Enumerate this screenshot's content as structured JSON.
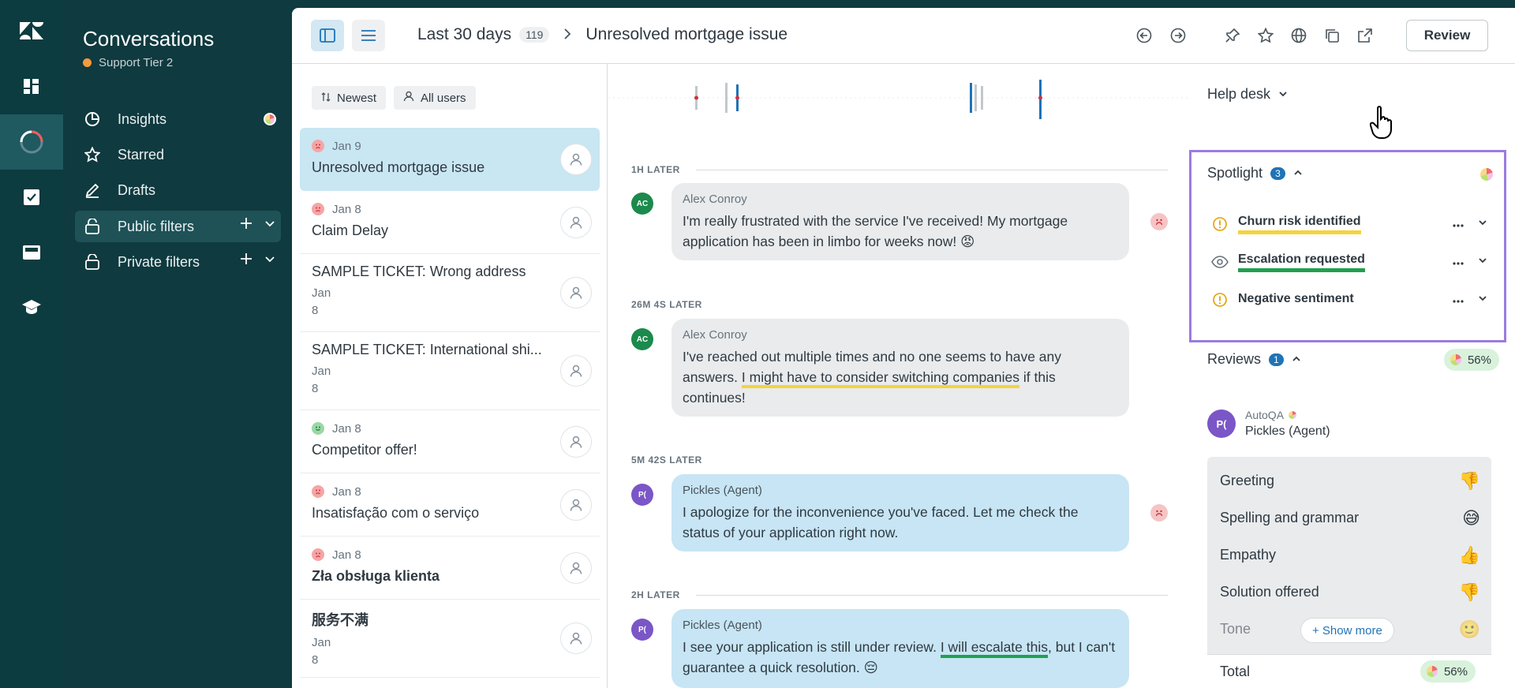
{
  "rail": {
    "items": [
      {
        "icon": "zendesk-logo-icon"
      },
      {
        "icon": "dashboard-icon"
      },
      {
        "icon": "qa-spinner-icon",
        "active": true
      },
      {
        "icon": "checklist-icon"
      },
      {
        "icon": "inbox-icon"
      },
      {
        "icon": "graduation-cap-icon"
      }
    ]
  },
  "nav": {
    "title": "Conversations",
    "workspace": "Support Tier 2",
    "items": [
      {
        "label": "Insights",
        "icon": "clock-chart-icon"
      },
      {
        "label": "Starred",
        "icon": "star-icon"
      },
      {
        "label": "Drafts",
        "icon": "pencil-icon"
      },
      {
        "label": "Public filters",
        "icon": "lock-icon",
        "selected": true
      },
      {
        "label": "Private filters",
        "icon": "lock-icon"
      }
    ]
  },
  "topbar": {
    "range": "Last 30 days",
    "count": "119",
    "separator": ">",
    "ticket_title": "Unresolved mortgage issue",
    "review_label": "Review"
  },
  "filters": {
    "sort": "Newest",
    "users": "All users"
  },
  "tickets": [
    {
      "date": "Jan 9",
      "subject": "Unresolved mortgage issue",
      "sentiment": "negative",
      "selected": true
    },
    {
      "date": "Jan 8",
      "subject": "Claim Delay",
      "sentiment": "negative"
    },
    {
      "subject": "SAMPLE TICKET: Wrong address",
      "date_line1": "Jan",
      "date_line2": "8"
    },
    {
      "subject": "SAMPLE TICKET: International shi...",
      "date_line1": "Jan",
      "date_line2": "8"
    },
    {
      "date": "Jan 8",
      "subject": "Competitor offer!",
      "sentiment": "positive"
    },
    {
      "date": "Jan 8",
      "subject": "Insatisfação com o serviço",
      "sentiment": "negative"
    },
    {
      "date": "Jan 8",
      "subject": "Zła obsługa klienta",
      "sentiment": "negative",
      "bold": true
    },
    {
      "subject": "服务不满",
      "date_line1": "Jan",
      "date_line2": "8",
      "bold": true
    }
  ],
  "conversation": {
    "dividers": [
      "1H LATER",
      "26M 4S LATER",
      "5M 42S LATER",
      "2H LATER"
    ],
    "messages": [
      {
        "initials": "AC",
        "author": "Alex Conroy",
        "role": "customer",
        "text": "I'm really frustrated with the service I've received! My mortgage application has been in limbo for weeks now! 😡",
        "sentiment": "negative"
      },
      {
        "initials": "AC",
        "author": "Alex Conroy",
        "role": "customer",
        "text_before": "I've reached out multiple times and no one seems to have any answers. ",
        "text_highlight": "I might have to consider switching companies",
        "text_after": " if this continues!"
      },
      {
        "initials": "P(",
        "author": "Pickles (Agent)",
        "role": "agent",
        "text": "I apologize for the inconvenience you've faced. Let me check the status of your application right now.",
        "sentiment": "negative"
      },
      {
        "initials": "P(",
        "author": "Pickles (Agent)",
        "role": "agent",
        "text_before": "I see your application is still under review. ",
        "text_highlight": "I will escalate this",
        "text_after": ", but I can't guarantee a quick resolution. 😔"
      }
    ]
  },
  "side": {
    "helpdesk": "Help desk",
    "spotlight": {
      "title": "Spotlight",
      "count": "3",
      "items": [
        {
          "label": "Churn risk identified",
          "icon": "alert-circle-icon",
          "underline": "#f5d33a"
        },
        {
          "label": "Escalation requested",
          "icon": "eye-icon",
          "underline": "#21a04f"
        },
        {
          "label": "Negative sentiment",
          "icon": "alert-circle-icon",
          "underline": ""
        }
      ]
    },
    "reviews": {
      "title": "Reviews",
      "count": "1",
      "score": "56%",
      "reviewer": "AutoQA",
      "agent": "Pickles (Agent)",
      "agent_initials": "P(",
      "categories": [
        {
          "label": "Greeting",
          "emoji": "👎"
        },
        {
          "label": "Spelling and grammar",
          "emoji": "😅"
        },
        {
          "label": "Empathy",
          "emoji": "👍"
        },
        {
          "label": "Solution offered",
          "emoji": "👎"
        },
        {
          "label": "Tone",
          "emoji": "🙂"
        }
      ],
      "show_more": "+ Show more",
      "total_label": "Total",
      "total_score": "56%"
    }
  },
  "colors": {
    "rail_bg": "#0c3b40",
    "accent_blue": "#1f73b7",
    "spotlight_border": "#9b7be0",
    "agent_bubble": "#c7e5f4",
    "customer_bubble": "#e9ebed"
  }
}
